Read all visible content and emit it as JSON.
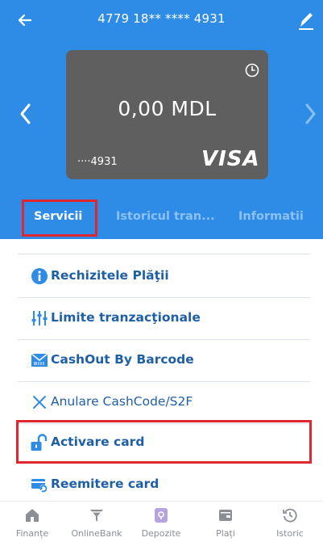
{
  "header": {
    "title": "4779 18** **** 4931",
    "back_icon": "arrow-left-icon",
    "edit_icon": "pencil-icon"
  },
  "card": {
    "balance": "0,00 MDL",
    "masked_number": "····4931",
    "brand": "VISA",
    "clock_icon": "clock-icon",
    "color": "#5f5f5f"
  },
  "tabs": [
    {
      "label": "Servicii",
      "active": true
    },
    {
      "label": "Istoricul tran...",
      "active": false
    },
    {
      "label": "Informatii",
      "active": false
    }
  ],
  "services": [
    {
      "label": "Rechizitele Plăţii",
      "icon": "info-icon"
    },
    {
      "label": "Limite tranzacţionale",
      "icon": "sliders-icon"
    },
    {
      "label": "CashOut By Barcode",
      "icon": "barcode-envelope-icon"
    },
    {
      "label": "Anulare CashCode/S2F",
      "icon": "x-icon"
    },
    {
      "label": "Activare card",
      "icon": "unlock-icon"
    },
    {
      "label": "Reemitere card",
      "icon": "card-refresh-icon"
    }
  ],
  "bottom_nav": [
    {
      "label": "Finanțe",
      "icon": "home-icon"
    },
    {
      "label": "OnlineBank",
      "icon": "filter-icon"
    },
    {
      "label": "Depozite",
      "icon": "deposit-icon"
    },
    {
      "label": "Plați",
      "icon": "wallet-icon"
    },
    {
      "label": "Istoric",
      "icon": "history-icon"
    }
  ],
  "colors": {
    "primary": "#2e8ce6",
    "link": "#1f5fa6",
    "highlight": "#e0262f",
    "nav_text": "#8a8f96"
  }
}
